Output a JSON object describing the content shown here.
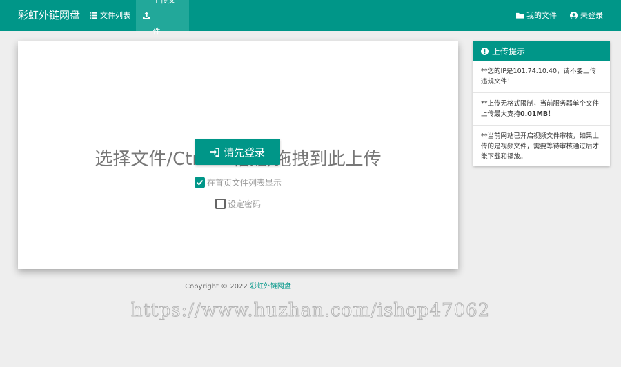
{
  "navbar": {
    "brand": "彩虹外链网盘",
    "items": [
      {
        "label": "文件列表",
        "icon": "list-icon"
      },
      {
        "label": "上传文件",
        "icon": "upload-icon",
        "active": true
      }
    ],
    "right_items": [
      {
        "label": "我的文件",
        "icon": "folder-icon"
      },
      {
        "label": "未登录",
        "icon": "user-icon"
      }
    ]
  },
  "upload": {
    "title": "选择文件/Ctrl+V粘贴/拖拽到此上传",
    "button_label": "请先登录",
    "show_on_index_label": "在首页文件列表显示",
    "show_on_index_checked": true,
    "set_password_label": "设定密码",
    "set_password_checked": false
  },
  "tips": {
    "title": "上传提示",
    "items": [
      {
        "text_before": "**您的IP是101.74.10.40，请不要上传违规文件！",
        "bold": "",
        "text_after": ""
      },
      {
        "text_before": "**上传无格式限制，当前服务器单个文件上传最大支持",
        "bold": "0.01MB",
        "text_after": "！"
      },
      {
        "text_before": "**当前网站已开启视频文件审核，如果上传的是视频文件，需要等待审核通过后才能下载和播放。",
        "bold": "",
        "text_after": ""
      }
    ]
  },
  "footer": {
    "copyright": "Copyright © 2022",
    "link": "彩虹外链网盘"
  },
  "watermark": "https://www.huzhan.com/ishop47062",
  "colors": {
    "primary": "#009688",
    "background": "#eeeeee"
  }
}
